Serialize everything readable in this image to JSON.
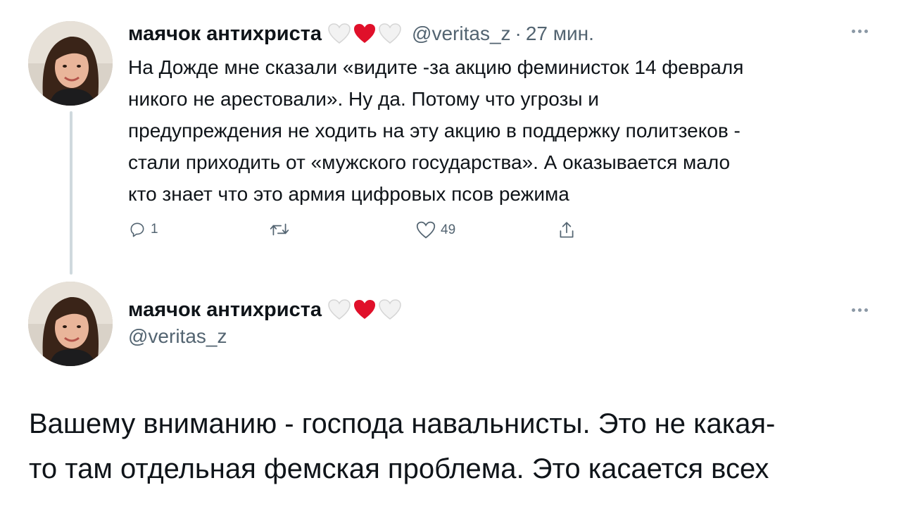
{
  "tweet1": {
    "author_name": "маячок антихриста",
    "handle": "@veritas_z",
    "separator": "·",
    "time": "27 мин.",
    "text_lines": [
      "На Дожде мне сказали «видите -за акцию феминисток 14 февраля",
      "никого не арестовали». Ну да. Потому что угрозы и",
      "предупреждения не ходить на эту акцию в поддержку политзеков -",
      "стали приходить от «мужского государства». А оказывается мало",
      "кто знает что это армия цифровых псов режима"
    ],
    "actions": {
      "reply_count": "1",
      "retweet_count": "",
      "like_count": "49"
    }
  },
  "tweet2": {
    "author_name": "маячок антихриста",
    "handle": "@veritas_z",
    "text_lines": [
      "Вашему вниманию - господа навальнисты. Это не какая-",
      "то там отдельная фемская проблема. Это касается всех"
    ]
  },
  "icons": {
    "name_emoji": [
      "white-heart-icon",
      "red-heart-icon",
      "white-heart-icon"
    ],
    "reply": "comment-icon",
    "retweet": "retweet-icon",
    "like": "heart-outline-icon",
    "share": "share-icon",
    "more": "more-dots-icon"
  },
  "colors": {
    "text": "#0f1419",
    "secondary": "#536471",
    "heart_red": "#e0102a",
    "thread_line": "#cfd9de"
  }
}
